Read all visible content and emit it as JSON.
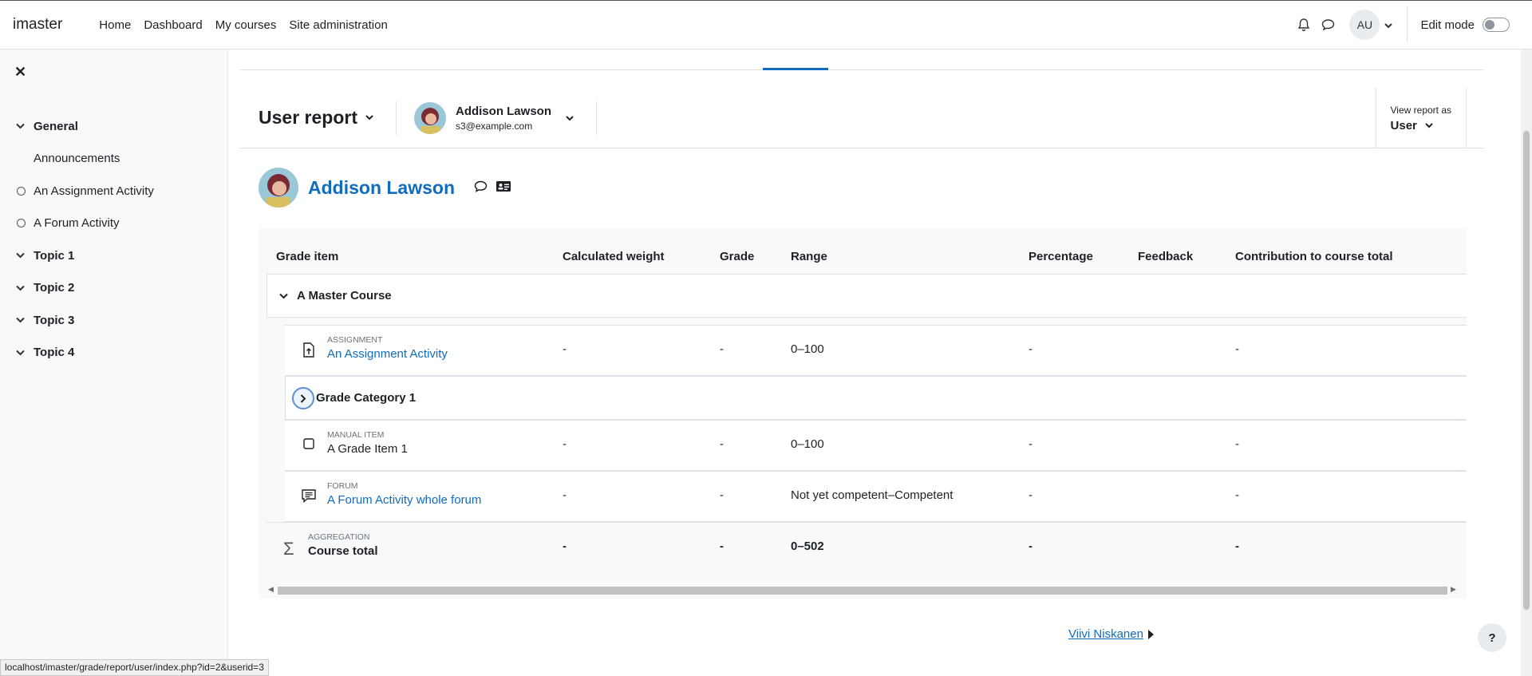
{
  "navbar": {
    "brand": "imaster",
    "links": [
      "Home",
      "Dashboard",
      "My courses",
      "Site administration"
    ],
    "user_initials": "AU",
    "edit_mode_label": "Edit mode",
    "edit_mode_on": false
  },
  "drawer": {
    "items": [
      {
        "label": "General",
        "kind": "section"
      },
      {
        "label": "Announcements",
        "kind": "sub"
      },
      {
        "label": "An Assignment Activity",
        "kind": "activity"
      },
      {
        "label": "A Forum Activity",
        "kind": "activity"
      },
      {
        "label": "Topic 1",
        "kind": "section"
      },
      {
        "label": "Topic 2",
        "kind": "section"
      },
      {
        "label": "Topic 3",
        "kind": "section"
      },
      {
        "label": "Topic 4",
        "kind": "section"
      }
    ]
  },
  "report": {
    "title": "User report",
    "user_name": "Addison Lawson",
    "user_email": "s3@example.com",
    "view_as_label": "View report as",
    "view_as_value": "User"
  },
  "heading": {
    "name": "Addison Lawson"
  },
  "table": {
    "headers": [
      "Grade item",
      "Calculated weight",
      "Grade",
      "Range",
      "Percentage",
      "Feedback",
      "Contribution to course total"
    ],
    "course": "A Master Course",
    "rows": [
      {
        "type": "ASSIGNMENT",
        "name": "An Assignment Activity",
        "weight": "-",
        "grade": "-",
        "range": "0–100",
        "percentage": "-",
        "feedback": "",
        "contribution": "-"
      },
      {
        "category": "Grade Category 1"
      },
      {
        "type": "MANUAL ITEM",
        "name": "A Grade Item 1",
        "weight": "-",
        "grade": "-",
        "range": "0–100",
        "percentage": "-",
        "feedback": "",
        "contribution": "-"
      },
      {
        "type": "FORUM",
        "name": "A Forum Activity whole forum",
        "weight": "-",
        "grade": "-",
        "range": "Not yet competent–Competent",
        "percentage": "-",
        "feedback": "",
        "contribution": "-"
      },
      {
        "type": "AGGREGATION",
        "name": "Course total",
        "weight": "-",
        "grade": "-",
        "range": "0–502",
        "percentage": "-",
        "feedback": "",
        "contribution": "-"
      }
    ]
  },
  "next_user": "Viivi Niskanen",
  "help_label": "?",
  "status_url": "localhost/imaster/grade/report/user/index.php?id=2&userid=3"
}
